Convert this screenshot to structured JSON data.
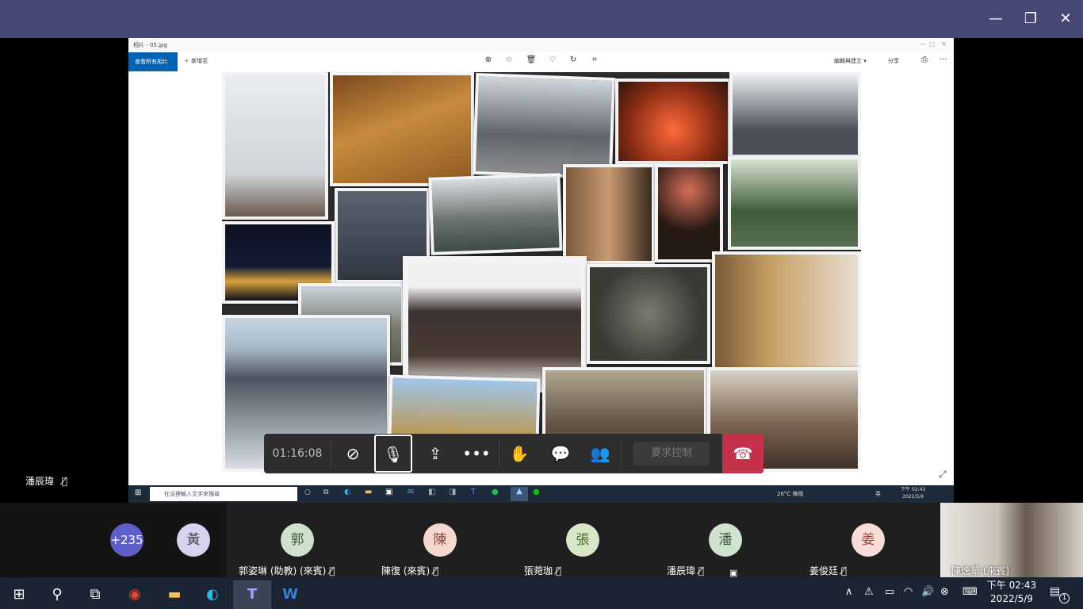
{
  "window": {
    "minimize_glyph": "—",
    "maximize_glyph": "❐",
    "close_glyph": "✕"
  },
  "viewer": {
    "title": "相片 - 05.jpg",
    "see_all": "查看所有相片",
    "add_to": "新增至",
    "edit_create": "編輯與建立",
    "share": "分享",
    "more": "···"
  },
  "shared_taskbar": {
    "search_placeholder": "在這裡輸入文字來搜尋",
    "weather": "26°C 陣雨",
    "ime": "英",
    "time": "下午 02:43",
    "date": "2022/5/9"
  },
  "call": {
    "timer": "01:16:08",
    "request_control": "要求控制"
  },
  "presenter": {
    "name": "潘辰瑋"
  },
  "participants": {
    "overflow_count": "+235",
    "huang_initial": "黃",
    "people": [
      {
        "initial": "郭",
        "name": "郭姿琳 (助教) (來賓)",
        "color": "#cfe0cf"
      },
      {
        "initial": "陳",
        "name": "陳復 (來賓)",
        "color": "#f5d7cf"
      },
      {
        "initial": "張",
        "name": "張菀珈",
        "color": "#d9e7c9"
      },
      {
        "initial": "潘",
        "name": "潘辰瑋",
        "color": "#cfe3cf"
      },
      {
        "initial": "姜",
        "name": "姜俊廷",
        "color": "#f7dcd7"
      }
    ],
    "video_name": "陳逸華 (來賓)"
  },
  "taskbar": {
    "time": "下午 02:43",
    "date": "2022/5/9",
    "notification_count": "1"
  },
  "colors": {
    "teams_titlebar": "#464775",
    "hangup": "#c4314b",
    "overflow_avatar": "#5b5fc7",
    "huang_avatar": "#d6d3ef"
  }
}
